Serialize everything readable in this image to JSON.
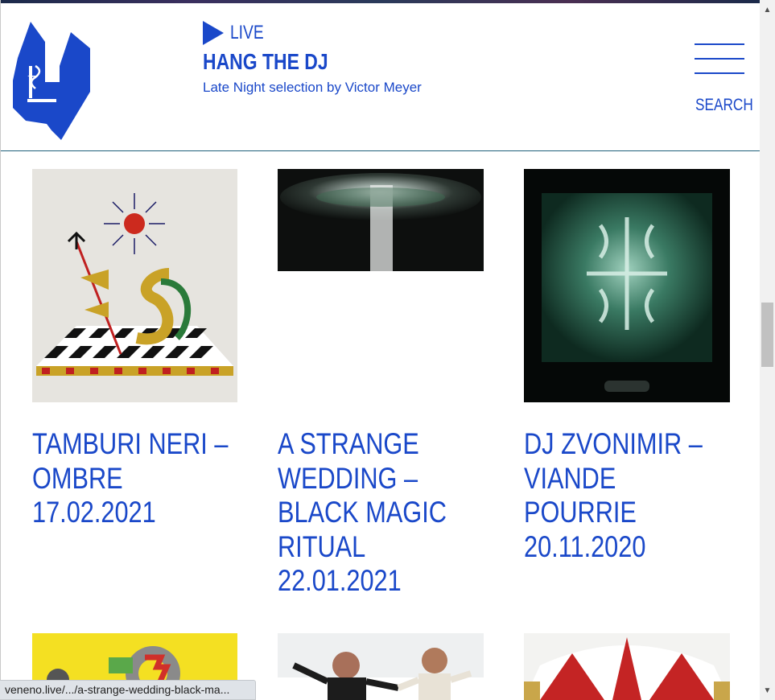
{
  "header": {
    "live_label": "LIVE",
    "show_title": "HANG THE DJ",
    "show_subtitle": "Late Night selection by Victor Meyer",
    "search_label": "SEARCH"
  },
  "cards": [
    {
      "title": "TAMBURI NERI – OMBRE",
      "title_lines": [
        "TAMBURI NERI –",
        "OMBRE"
      ],
      "date": "17.02.2021"
    },
    {
      "title": "A STRANGE WEDDING – BLACK MAGIC RITUAL",
      "title_lines": [
        "A STRANGE",
        "WEDDING –",
        "BLACK MAGIC",
        "RITUAL"
      ],
      "date": "22.01.2021"
    },
    {
      "title": "DJ ZVONIMIR – VIANDE POURRIE",
      "title_lines": [
        "DJ ZVONIMIR –",
        "VIANDE POURRIE"
      ],
      "date": "20.11.2020"
    }
  ],
  "status_bar": {
    "url": "veneno.live/.../a-strange-wedding-black-ma..."
  },
  "colors": {
    "brand_blue": "#1a48c9",
    "divider": "#1f5f7a"
  }
}
